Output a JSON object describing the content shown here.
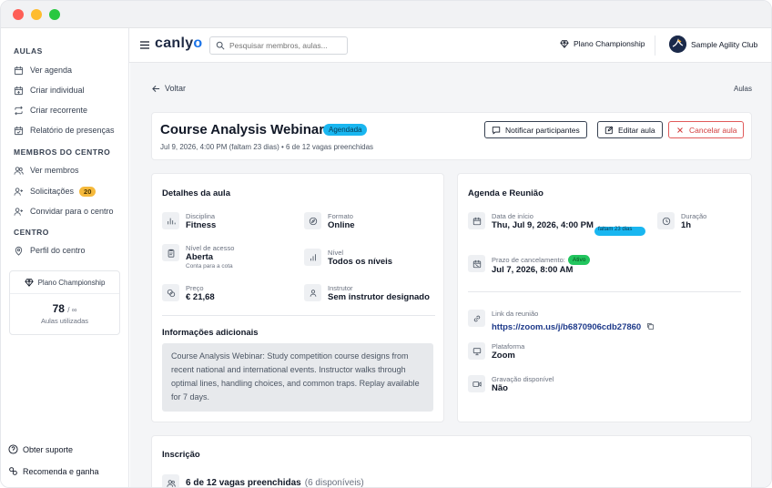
{
  "sidebar": {
    "sections": [
      {
        "title": "AULAS",
        "items": [
          {
            "label": "Ver agenda",
            "icon": "calendar-icon"
          },
          {
            "label": "Criar individual",
            "icon": "calendar-plus-icon"
          },
          {
            "label": "Criar recorrente",
            "icon": "repeat-icon"
          },
          {
            "label": "Relatório de presenças",
            "icon": "calendar-check-icon"
          }
        ]
      },
      {
        "title": "MEMBROS DO CENTRO",
        "items": [
          {
            "label": "Ver membros",
            "icon": "users-icon"
          },
          {
            "label": "Solicitações",
            "icon": "user-plus-icon",
            "badge": "20"
          },
          {
            "label": "Convidar para o centro",
            "icon": "user-add-icon"
          }
        ]
      },
      {
        "title": "CENTRO",
        "items": [
          {
            "label": "Perfil do centro",
            "icon": "map-pin-icon"
          }
        ]
      }
    ],
    "plan": {
      "name": "Plano Championship",
      "used": "78",
      "limit": "∞",
      "sublabel": "Aulas utilizadas"
    },
    "footer": [
      {
        "label": "Obter suporte",
        "icon": "help-circle-icon"
      },
      {
        "label": "Recomenda e ganha",
        "icon": "gift-icon"
      }
    ]
  },
  "topbar": {
    "logo": "canly",
    "logo_accent": "o",
    "search_placeholder": "Pesquisar membros, aulas...",
    "plan_label": "Plano Championship",
    "club_name": "Sample Agility Club"
  },
  "page": {
    "back_label": "Voltar",
    "breadcrumb_right": "Aulas",
    "title": "Course Analysis Webinar",
    "status": "Agendada",
    "meta": "Jul 9, 2026, 4:00 PM (faltam 23 dias)  •  6 de 12 vagas preenchidas",
    "buttons": {
      "notify": "Notificar participantes",
      "edit": "Editar aula",
      "cancel": "Cancelar aula"
    }
  },
  "details": {
    "title": "Detalhes da aula",
    "fields": {
      "discipline": {
        "label": "Disciplina",
        "value": "Fitness"
      },
      "format": {
        "label": "Formato",
        "value": "Online"
      },
      "access": {
        "label": "Nível de acesso",
        "value": "Aberta",
        "sub": "Conta para a cota"
      },
      "level": {
        "label": "Nível",
        "value": "Todos os níveis"
      },
      "price": {
        "label": "Preço",
        "value": "€ 21,68"
      },
      "instructor": {
        "label": "Instrutor",
        "value": "Sem instrutor designado"
      }
    },
    "additional_title": "Informações adicionais",
    "description": "Course Analysis Webinar: Study competition course designs from recent national and international events. Instructor walks through optimal lines, handling choices, and common traps. Replay available for 7 days."
  },
  "agenda": {
    "title": "Agenda e Reunião",
    "start": {
      "label": "Data de início",
      "value": "Thu, Jul 9, 2026, 4:00 PM",
      "pill": "faltam 23 dias"
    },
    "duration": {
      "label": "Duração",
      "value": "1h"
    },
    "cancel_deadline": {
      "label": "Prazo de cancelamento:",
      "pill": "Ativo",
      "value": "Jul 7, 2026, 8:00 AM"
    },
    "meeting_link": {
      "label": "Link da reunião",
      "value": "https://zoom.us/j/b6870906cdb27860"
    },
    "platform": {
      "label": "Plataforma",
      "value": "Zoom"
    },
    "recording": {
      "label": "Gravação disponível",
      "value": "Não"
    }
  },
  "enrollment": {
    "title": "Inscrição",
    "summary": "6 de 12 vagas preenchidas",
    "available": "(6 disponíveis)"
  },
  "colors": {
    "accent": "#19b6f0",
    "success": "#22c55e",
    "danger": "#d23b3b",
    "badge": "#f5b93b"
  }
}
